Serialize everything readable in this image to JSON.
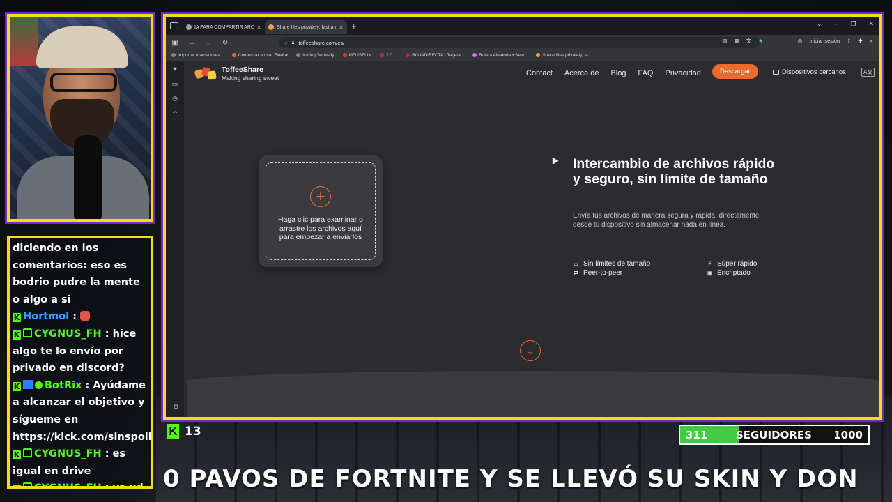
{
  "chat": {
    "lines": [
      {
        "text": "diciendo en los comentarios: eso es bodrio pudre la mente o algo a si"
      },
      {
        "user": "Hortmol",
        "user_color": "#3ea0ff",
        "message": " : "
      },
      {
        "user": "CYGNUS_FH",
        "user_color": "#53fc18",
        "message": " : hice algo te lo envío por privado en discord?"
      },
      {
        "user": "BotRix",
        "user_color": "#53fc18",
        "message": " : Ayúdame a alcanzar el objetivo y sígueme en https://kick.com/sinspoiler"
      },
      {
        "user": "CYGNUS_FH",
        "user_color": "#53fc18",
        "message": " : es igual en drive"
      },
      {
        "user": "CYGNUS_FH",
        "user_color": "#53fc18",
        "message": " : ya xd"
      }
    ]
  },
  "browser": {
    "tabs": [
      {
        "label": "IA PARA COMPARTIR ARCHIVOS",
        "icon": "page-icon",
        "active": false
      },
      {
        "label": "Share files privately, fast and w",
        "icon": "toffee-icon",
        "active": true
      }
    ],
    "url": "toffeeshare.com/es/",
    "signin_label": "Iniciar sesión",
    "bookmarks": [
      "Importar marcadores...",
      "Comenzar a usar Firefox",
      "Inicio | SeriesJy",
      "PELISFLIX",
      "2.0 ...",
      "ROJADIRECTA | Tarjeta...",
      "Ruleta Aleatoria • Sele...",
      "Share files privately, fa..."
    ]
  },
  "site": {
    "brand_name": "ToffeeShare",
    "brand_tagline": "Making sharing sweet",
    "nav": [
      "Contact",
      "Acerca de",
      "Blog",
      "FAQ",
      "Privacidad"
    ],
    "download_label": "Descargar",
    "nearby_label": "Dispositivos cercanos",
    "lang_label": "A文",
    "drop_text": "Haga clic para examinar o arrastre los archivos aquí para empezar a enviarlos",
    "hero_title": "Intercambio de archivos rápido y seguro, sin límite de tamaño",
    "hero_desc": "Envía tus archivos de manera segura y rápida, directamente desde tu dispositivo sin almacenar nada en línea.",
    "features": [
      {
        "label": "Sin límites de tamaño",
        "icon": "infinity-icon"
      },
      {
        "label": "Súper rápido",
        "icon": "lightning-icon"
      },
      {
        "label": "Peer-to-peer",
        "icon": "swap-icon"
      },
      {
        "label": "Encriptado",
        "icon": "lock-icon"
      }
    ],
    "accent": "#ec6a2c"
  },
  "overlay": {
    "viewer_count": "13",
    "goal_current": "311",
    "goal_label": "SEGUIDORES",
    "goal_max": "1000",
    "goal_fraction": 0.311,
    "ticker": "0 PAVOS DE FORTNITE Y SE LLEVÓ SU SKIN Y DON",
    "frame_color": "#f0e010",
    "kick_green": "#53fc18"
  }
}
